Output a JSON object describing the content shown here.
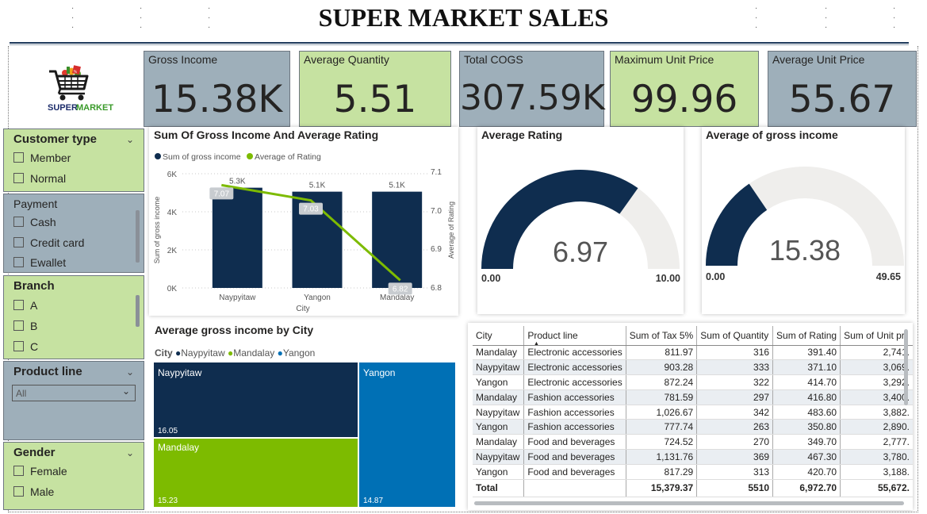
{
  "title": "SUPER MARKET SALES",
  "logo": {
    "text_super": "SUPER",
    "text_market": "MARKET",
    "icon": "shopping-cart-icon"
  },
  "kpis": [
    {
      "label": "Gross Income",
      "value": "15.38K",
      "style": "grey"
    },
    {
      "label": "Average Quantity",
      "value": "5.51",
      "style": "green"
    },
    {
      "label": "Total COGS",
      "value": "307.59K",
      "style": "grey"
    },
    {
      "label": "Maximum Unit Price",
      "value": "99.96",
      "style": "green"
    },
    {
      "label": "Average Unit Price",
      "value": "55.67",
      "style": "grey"
    }
  ],
  "slicers": {
    "customer_type": {
      "title": "Customer type",
      "options": [
        "Member",
        "Normal"
      ]
    },
    "payment": {
      "title": "Payment",
      "options": [
        "Cash",
        "Credit card",
        "Ewallet"
      ]
    },
    "branch": {
      "title": "Branch",
      "options": [
        "A",
        "B",
        "C"
      ]
    },
    "product_line": {
      "title": "Product line",
      "selected": "All"
    },
    "gender": {
      "title": "Gender",
      "options": [
        "Female",
        "Male"
      ]
    }
  },
  "colors": {
    "navy": "#0f2d4f",
    "green": "#7dbb00",
    "blue": "#0070b5",
    "kpi_grey": "#9eafba",
    "kpi_green": "#c6e2a1",
    "gauge_track": "#efeeec"
  },
  "combo": {
    "title": "Sum Of Gross Income And Average Rating",
    "legend": [
      "Sum of gross income",
      "Average of Rating"
    ],
    "xlabel": "City",
    "ylabel_left": "Sum of gross income",
    "ylabel_right": "Average of Rating",
    "left_ticks": [
      "6K",
      "4K",
      "2K",
      "0K"
    ],
    "right_ticks": [
      "7.1",
      "7.0",
      "6.9",
      "6.8"
    ]
  },
  "gauge_rating": {
    "title": "Average Rating",
    "value": "6.97",
    "min": "0.00",
    "max": "10.00",
    "fraction": 0.697
  },
  "gauge_income": {
    "title": "Average of gross income",
    "value": "15.38",
    "min": "0.00",
    "max": "49.65",
    "fraction": 0.3098
  },
  "treemap": {
    "title": "Average gross income by City",
    "legend_title": "City",
    "legend": [
      "Naypyitaw",
      "Mandalay",
      "Yangon"
    ],
    "items": [
      {
        "city": "Naypyitaw",
        "value": "16.05"
      },
      {
        "city": "Mandalay",
        "value": "15.23"
      },
      {
        "city": "Yangon",
        "value": "14.87"
      }
    ]
  },
  "table": {
    "columns": [
      "City",
      "Product line",
      "Sum of Tax 5%",
      "Sum of Quantity",
      "Sum of Rating",
      "Sum of Unit pri"
    ],
    "rows": [
      [
        "Mandalay",
        "Electronic accessories",
        "811.97",
        "316",
        "391.40",
        "2,741."
      ],
      [
        "Naypyitaw",
        "Electronic accessories",
        "903.28",
        "333",
        "371.10",
        "3,069."
      ],
      [
        "Yangon",
        "Electronic accessories",
        "872.24",
        "322",
        "414.70",
        "3,292."
      ],
      [
        "Mandalay",
        "Fashion accessories",
        "781.59",
        "297",
        "416.80",
        "3,400."
      ],
      [
        "Naypyitaw",
        "Fashion accessories",
        "1,026.67",
        "342",
        "483.60",
        "3,882."
      ],
      [
        "Yangon",
        "Fashion accessories",
        "777.74",
        "263",
        "350.80",
        "2,890."
      ],
      [
        "Mandalay",
        "Food and beverages",
        "724.52",
        "270",
        "349.70",
        "2,777."
      ],
      [
        "Naypyitaw",
        "Food and beverages",
        "1,131.76",
        "369",
        "467.30",
        "3,780."
      ],
      [
        "Yangon",
        "Food and beverages",
        "817.29",
        "313",
        "420.70",
        "3,188."
      ]
    ],
    "total": [
      "Total",
      "",
      "15,379.37",
      "5510",
      "6,972.70",
      "55,672."
    ]
  },
  "chart_data": [
    {
      "type": "bar",
      "title": "Sum Of Gross Income And Average Rating",
      "categories": [
        "Naypyitaw",
        "Yangon",
        "Mandalay"
      ],
      "series": [
        {
          "name": "Sum of gross income",
          "type": "bar",
          "values": [
            5265.18,
            5057.16,
            5057.03
          ],
          "labels": [
            "5.3K",
            "5.1K",
            "5.1K"
          ]
        },
        {
          "name": "Average of Rating",
          "type": "line",
          "values": [
            7.07,
            7.03,
            6.82
          ],
          "labels": [
            "7.07",
            "7.03",
            "6.82"
          ]
        }
      ],
      "xlabel": "City",
      "ylabel": "Sum of gross income",
      "ylim": [
        0,
        6000
      ],
      "y2label": "Average of Rating",
      "y2lim": [
        6.8,
        7.1
      ]
    },
    {
      "type": "treemap",
      "title": "Average gross income by City",
      "categories": [
        "Naypyitaw",
        "Mandalay",
        "Yangon"
      ],
      "values": [
        16.05,
        15.23,
        14.87
      ]
    }
  ]
}
